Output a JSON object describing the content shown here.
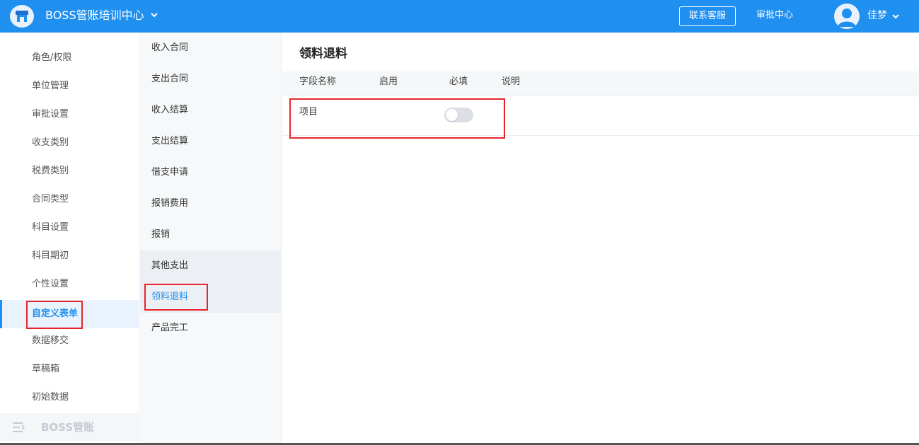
{
  "header": {
    "org_title": "BOSS管账培训中心",
    "contact_label": "联系客服",
    "approval_label": "审批中心",
    "user_name": "佳梦",
    "accent_color": "#1f8ff0"
  },
  "sidebar": {
    "items": [
      {
        "label": "角色/权限"
      },
      {
        "label": "单位管理"
      },
      {
        "label": "审批设置"
      },
      {
        "label": "收支类别"
      },
      {
        "label": "税费类别"
      },
      {
        "label": "合同类型"
      },
      {
        "label": "科目设置"
      },
      {
        "label": "科目期初"
      },
      {
        "label": "个性设置"
      },
      {
        "label": "自定义表单",
        "active": true
      },
      {
        "label": "数据移交"
      },
      {
        "label": "草稿箱"
      },
      {
        "label": "初始数据"
      }
    ],
    "footer_label": "BOSS管账"
  },
  "subnav": {
    "items": [
      {
        "label": "收入合同"
      },
      {
        "label": "支出合同"
      },
      {
        "label": "收入结算"
      },
      {
        "label": "支出结算"
      },
      {
        "label": "借支申请"
      },
      {
        "label": "报销费用"
      },
      {
        "label": "报销"
      },
      {
        "label": "其他支出"
      },
      {
        "label": "领料退料",
        "active": true
      },
      {
        "label": "产品完工"
      }
    ]
  },
  "main": {
    "title": "领料退料",
    "columns": [
      "字段名称",
      "启用",
      "必填",
      "说明"
    ],
    "rows": [
      {
        "field_name": "项目",
        "enabled": false,
        "required": "",
        "description": ""
      }
    ]
  },
  "icons": {
    "logo": "store-icon",
    "org_caret": "chevron-down-icon",
    "avatar": "user-avatar-icon",
    "user_caret": "chevron-down-icon",
    "footer": "menu-collapse-icon"
  }
}
